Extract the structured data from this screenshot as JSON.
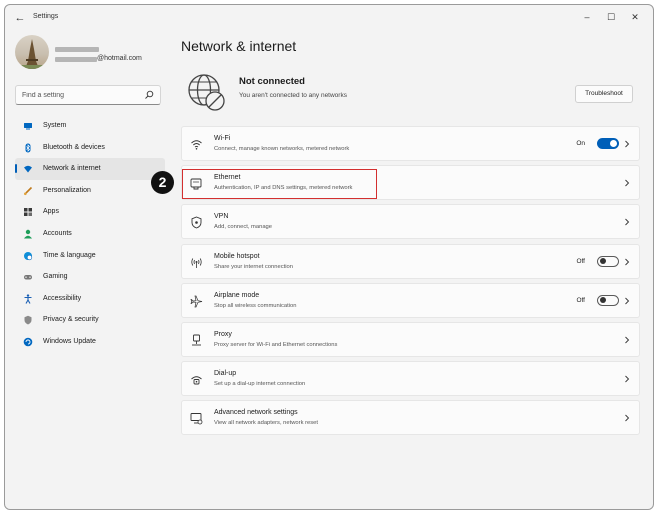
{
  "window": {
    "title": "Settings"
  },
  "user": {
    "email_suffix": "@hotmail.com"
  },
  "search": {
    "placeholder": "Find a setting"
  },
  "sidebar": {
    "items": [
      {
        "label": "System",
        "icon": "system-icon",
        "selected": false
      },
      {
        "label": "Bluetooth & devices",
        "icon": "bluetooth-icon",
        "selected": false
      },
      {
        "label": "Network & internet",
        "icon": "wifi-icon",
        "selected": true
      },
      {
        "label": "Personalization",
        "icon": "brush-icon",
        "selected": false
      },
      {
        "label": "Apps",
        "icon": "apps-icon",
        "selected": false
      },
      {
        "label": "Accounts",
        "icon": "person-icon",
        "selected": false
      },
      {
        "label": "Time & language",
        "icon": "globe-clock-icon",
        "selected": false
      },
      {
        "label": "Gaming",
        "icon": "gamepad-icon",
        "selected": false
      },
      {
        "label": "Accessibility",
        "icon": "accessibility-icon",
        "selected": false
      },
      {
        "label": "Privacy & security",
        "icon": "shield-icon",
        "selected": false
      },
      {
        "label": "Windows Update",
        "icon": "update-icon",
        "selected": false
      }
    ]
  },
  "main": {
    "title": "Network & internet",
    "status": {
      "title": "Not connected",
      "subtitle": "You aren't connected to any networks",
      "troubleshoot_label": "Troubleshoot"
    },
    "cards": [
      {
        "title": "Wi-Fi",
        "subtitle": "Connect, manage known networks, metered network",
        "icon": "wifi-icon",
        "toggle": "On"
      },
      {
        "title": "Ethernet",
        "subtitle": "Authentication, IP and DNS settings, metered network",
        "icon": "ethernet-icon"
      },
      {
        "title": "VPN",
        "subtitle": "Add, connect, manage",
        "icon": "vpn-shield-icon"
      },
      {
        "title": "Mobile hotspot",
        "subtitle": "Share your internet connection",
        "icon": "hotspot-icon",
        "toggle": "Off"
      },
      {
        "title": "Airplane mode",
        "subtitle": "Stop all wireless communication",
        "icon": "airplane-icon",
        "toggle": "Off"
      },
      {
        "title": "Proxy",
        "subtitle": "Proxy server for Wi-Fi and Ethernet connections",
        "icon": "proxy-icon"
      },
      {
        "title": "Dial-up",
        "subtitle": "Set up a dial-up internet connection",
        "icon": "dialup-icon"
      },
      {
        "title": "Advanced network settings",
        "subtitle": "View all network adapters, network reset",
        "icon": "advanced-network-icon"
      }
    ]
  },
  "annotation": {
    "step_number": "2"
  },
  "colors": {
    "accent": "#005fb8",
    "highlight": "#d32f2f",
    "background": "#f3f3f3",
    "card": "#fbfbfb"
  }
}
